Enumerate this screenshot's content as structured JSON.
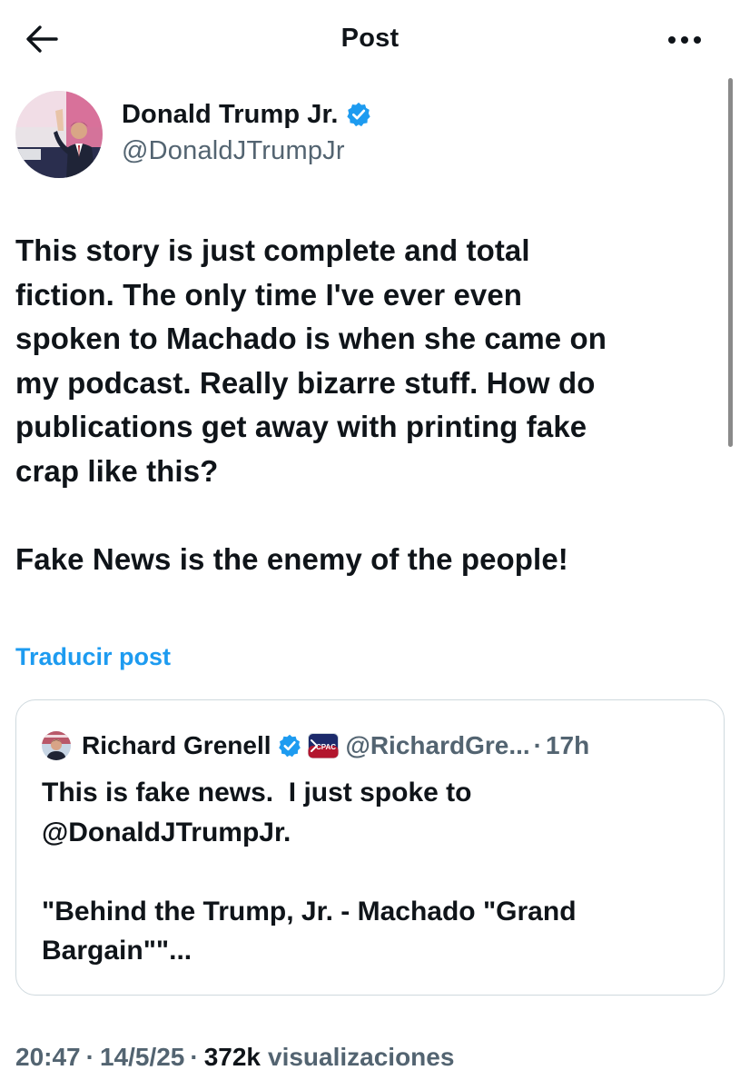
{
  "header": {
    "title": "Post",
    "back_icon": "arrow-left-icon",
    "more_icon": "more-horizontal-icon"
  },
  "post": {
    "author": {
      "name": "Donald Trump Jr.",
      "handle": "@DonaldJTrumpJr",
      "verified": true
    },
    "text": "This story is just complete and total\nfiction. The only time I've ever even\nspoken to Machado is when she came on\nmy podcast. Really bizarre stuff. How do\npublications get away with printing fake\ncrap like this?\n\nFake News is the enemy of the people!",
    "translate_label": "Traducir post",
    "time": "20:47",
    "date": "14/5/25",
    "separator": "·",
    "views_count": "372k",
    "views_label": "visualizaciones"
  },
  "quote": {
    "author_name": "Richard Grenell",
    "handle": "@RichardGre...",
    "separator": "·",
    "time": "17h",
    "affiliate_badge_text": "CPAC",
    "text": "This is fake news.  I just spoke to\n@DonaldJTrumpJr.\n\n\"Behind the Trump, Jr. - Machado \"Grand\nBargain\"\"..."
  },
  "colors": {
    "text": "#0f1419",
    "secondary": "#536471",
    "link": "#1d9bf0",
    "verified": "#1d9bf0",
    "border": "#cfd9de"
  }
}
